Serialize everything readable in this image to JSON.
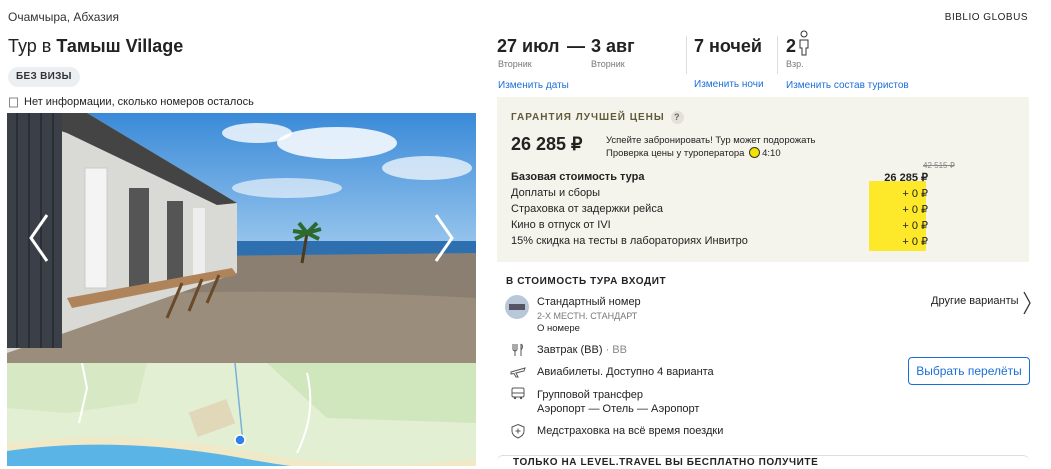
{
  "location": "Очамчыра, Абхазия",
  "operator": "BIBLIO GLOBUS",
  "title": {
    "prefix": "Тур в ",
    "hotel": "Тамыш Village"
  },
  "visa_badge": "БЕЗ ВИЗЫ",
  "rooms_info": "Нет информации, сколько номеров осталось",
  "dates": {
    "start": "27 июл",
    "start_day": "Вторник",
    "dash": "—",
    "end": "3 авг",
    "end_day": "Вторник",
    "change_dates": "Изменить даты",
    "nights": "7 ночей",
    "change_nights": "Изменить ночи",
    "adults": "2",
    "adults_label": "Взр.",
    "change_tourists": "Изменить состав туристов"
  },
  "guarantee": {
    "title": "ГАРАНТИЯ ЛУЧШЕЙ ЦЕНЫ",
    "qmark": "?",
    "price": "26 285 ₽",
    "hurry_line1": "Успейте забронировать! Тур может подорожать",
    "hurry_line2": "Проверка цены у туроператора",
    "timer": "4:10",
    "old_price": "42 515 ₽",
    "rows": [
      {
        "label": "Базовая стоимость тура",
        "value": "26 285 ₽"
      },
      {
        "label": "Доплаты и сборы",
        "value": "+ 0 ₽"
      },
      {
        "label": "Страховка от задержки рейса",
        "value": "+ 0 ₽"
      },
      {
        "label": "Кино в отпуск от IVI",
        "value": "+ 0 ₽"
      },
      {
        "label": "15% скидка на тесты в лабораториях Инвитро",
        "value": "+ 0 ₽"
      }
    ]
  },
  "included": {
    "title": "В СТОИМОСТЬ ТУРА ВХОДИТ",
    "room": "Стандартный номер",
    "room_type": "2-Х МЕСТН. СТАНДАРТ",
    "room_link": "О номере",
    "other_variants": "Другие варианты",
    "meal": "Завтрак (BB)",
    "meal_code": "· BB",
    "flights": "Авиабилеты. Доступно 4 варианта",
    "flights_button": "Выбрать перелёты",
    "transfer": "Групповой трансфер",
    "transfer_route": "Аэропорт — Отель — Аэропорт",
    "insurance": "Медстраховка на всё время поездки"
  },
  "bottom_title": "ТОЛЬКО НА LEVEL.TRAVEL ВЫ БЕСПЛАТНО ПОЛУЧИТЕ",
  "colors": {
    "link": "#1a6ed8",
    "highlight": "#fde829",
    "guarantee_bg": "#f5f4ec",
    "sea": "#5ab4e6"
  }
}
